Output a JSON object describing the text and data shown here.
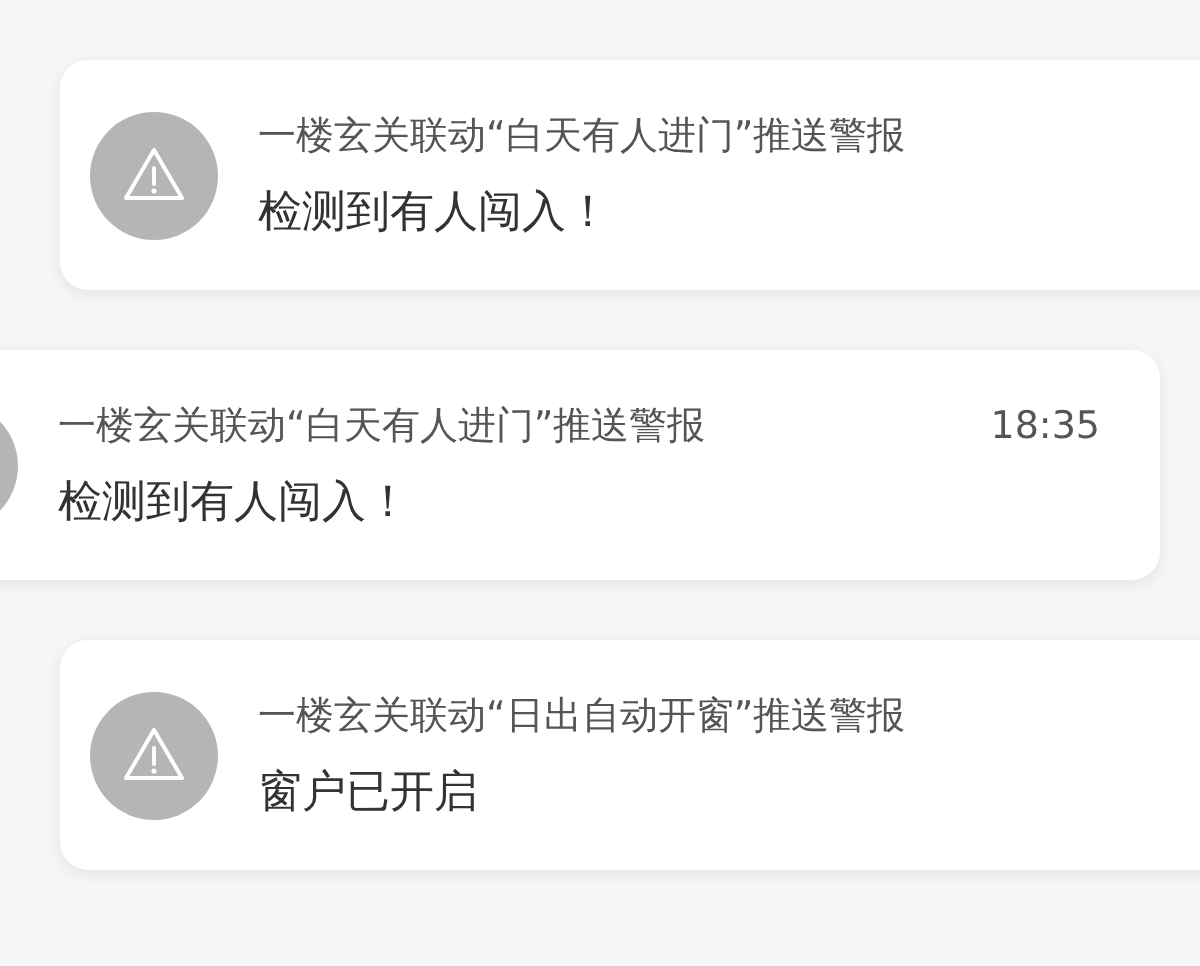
{
  "notifications": [
    {
      "title": "一楼玄关联动“白天有人进门”推送警报",
      "message": "检测到有人闯入！"
    },
    {
      "title": "一楼玄关联动“白天有人进门”推送警报",
      "message": "检测到有人闯入！",
      "time": "18:35"
    },
    {
      "title": "一楼玄关联动“日出自动开窗”推送警报",
      "message": "窗户已开启"
    }
  ]
}
